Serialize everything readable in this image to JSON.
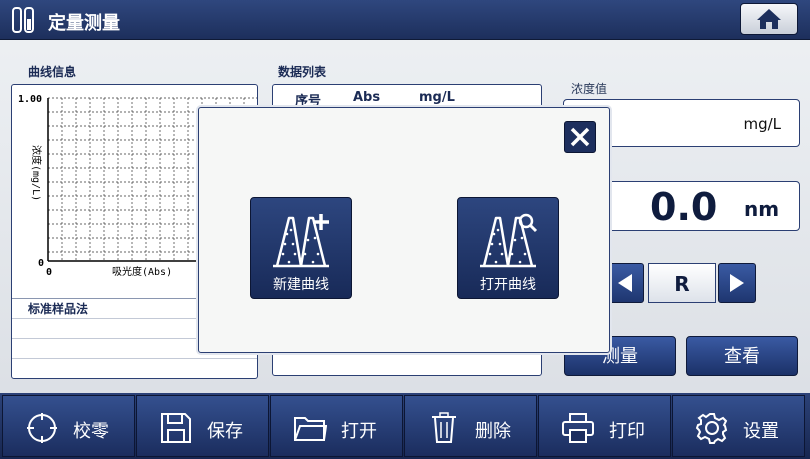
{
  "header": {
    "title": "定量测量",
    "home_icon": "home-icon"
  },
  "curve_info": {
    "label": "曲线信息",
    "y_max_label": "1.00",
    "y_min_label": "0",
    "x_min_label": "0",
    "y_axis_label": "浓度(mg/L)",
    "x_axis_label": "吸光度(Abs)",
    "method_label": "标准样品法"
  },
  "data_list": {
    "label": "数据列表",
    "columns": [
      "序号",
      "Abs",
      "mg/L"
    ]
  },
  "concentration": {
    "label": "浓度值",
    "unit": "mg/L"
  },
  "wavelength": {
    "value": "0.0",
    "unit": "nm"
  },
  "mode": {
    "value": "R"
  },
  "actions": {
    "measure_label": "测量",
    "view_label": "查看"
  },
  "toolbar": {
    "items": [
      {
        "label": "校零",
        "icon": "crosshair-icon"
      },
      {
        "label": "保存",
        "icon": "save-icon"
      },
      {
        "label": "打开",
        "icon": "folder-icon"
      },
      {
        "label": "删除",
        "icon": "trash-icon"
      },
      {
        "label": "打印",
        "icon": "printer-icon"
      },
      {
        "label": "设置",
        "icon": "gear-icon"
      }
    ]
  },
  "dialog": {
    "new_curve_label": "新建曲线",
    "open_curve_label": "打开曲线",
    "close_icon": "close-icon"
  },
  "colors": {
    "navy": "#1d2f5c",
    "button_blue": "#2d467f",
    "panel_border": "#2b3f73"
  }
}
